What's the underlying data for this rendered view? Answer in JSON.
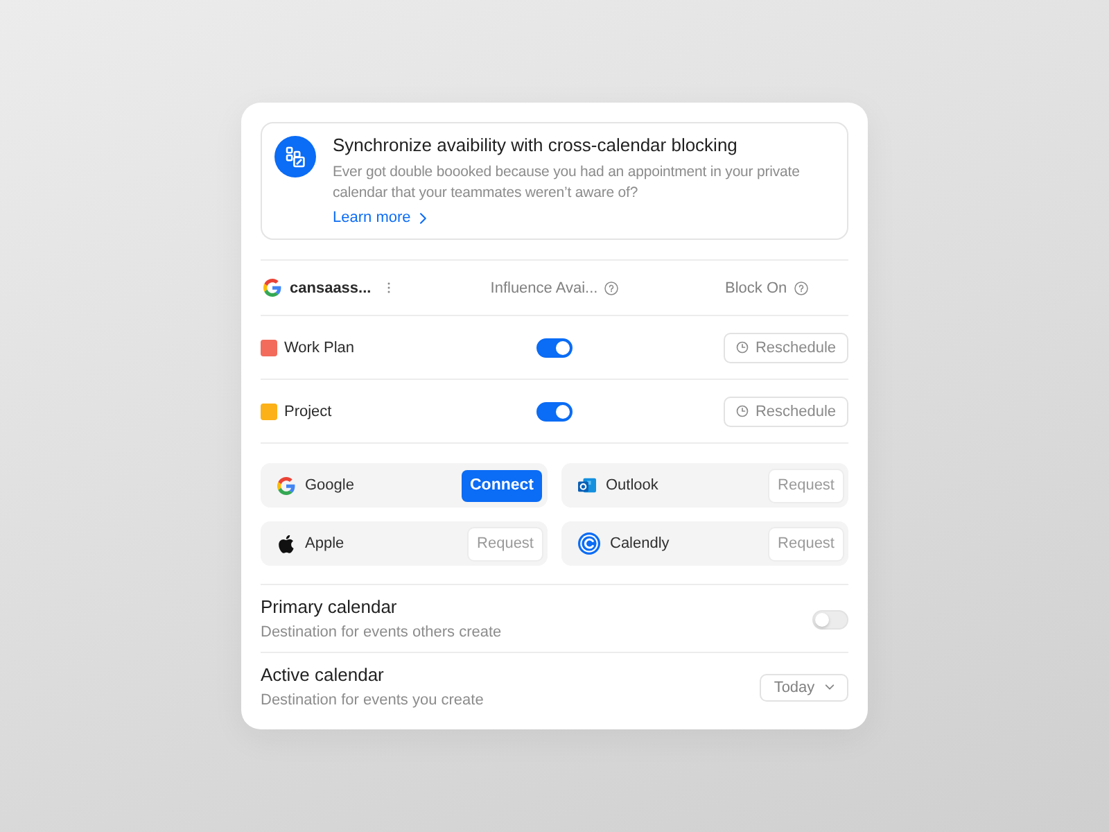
{
  "banner": {
    "title": "Synchronize avaibility with cross-calendar blocking",
    "body": "Ever got double boooked because you had an appointment in your private calendar that your teammates weren’t aware of?",
    "link": "Learn more"
  },
  "account": {
    "name": "cansaass...",
    "columns": [
      "Influence Avai...",
      "Block On"
    ]
  },
  "calendars": [
    {
      "name": "Work Plan",
      "color": "#f26b5b",
      "on": true,
      "action": "Reschedule"
    },
    {
      "name": "Project",
      "color": "#fbb117",
      "on": true,
      "action": "Reschedule"
    }
  ],
  "integrations": [
    {
      "kind": "google",
      "name": "Google",
      "button": "Connect",
      "primary": true
    },
    {
      "kind": "outlook",
      "name": "Outlook",
      "button": "Request",
      "primary": false
    },
    {
      "kind": "apple",
      "name": "Apple",
      "button": "Request",
      "primary": false
    },
    {
      "kind": "calendly",
      "name": "Calendly",
      "button": "Request",
      "primary": false
    }
  ],
  "settings": [
    {
      "kind": "toggle",
      "title": "Primary calendar",
      "subtitle": "Destination for events others create",
      "on": false
    },
    {
      "kind": "select",
      "title": "Active calendar",
      "subtitle": "Destination for events you create",
      "value": "Today"
    }
  ]
}
